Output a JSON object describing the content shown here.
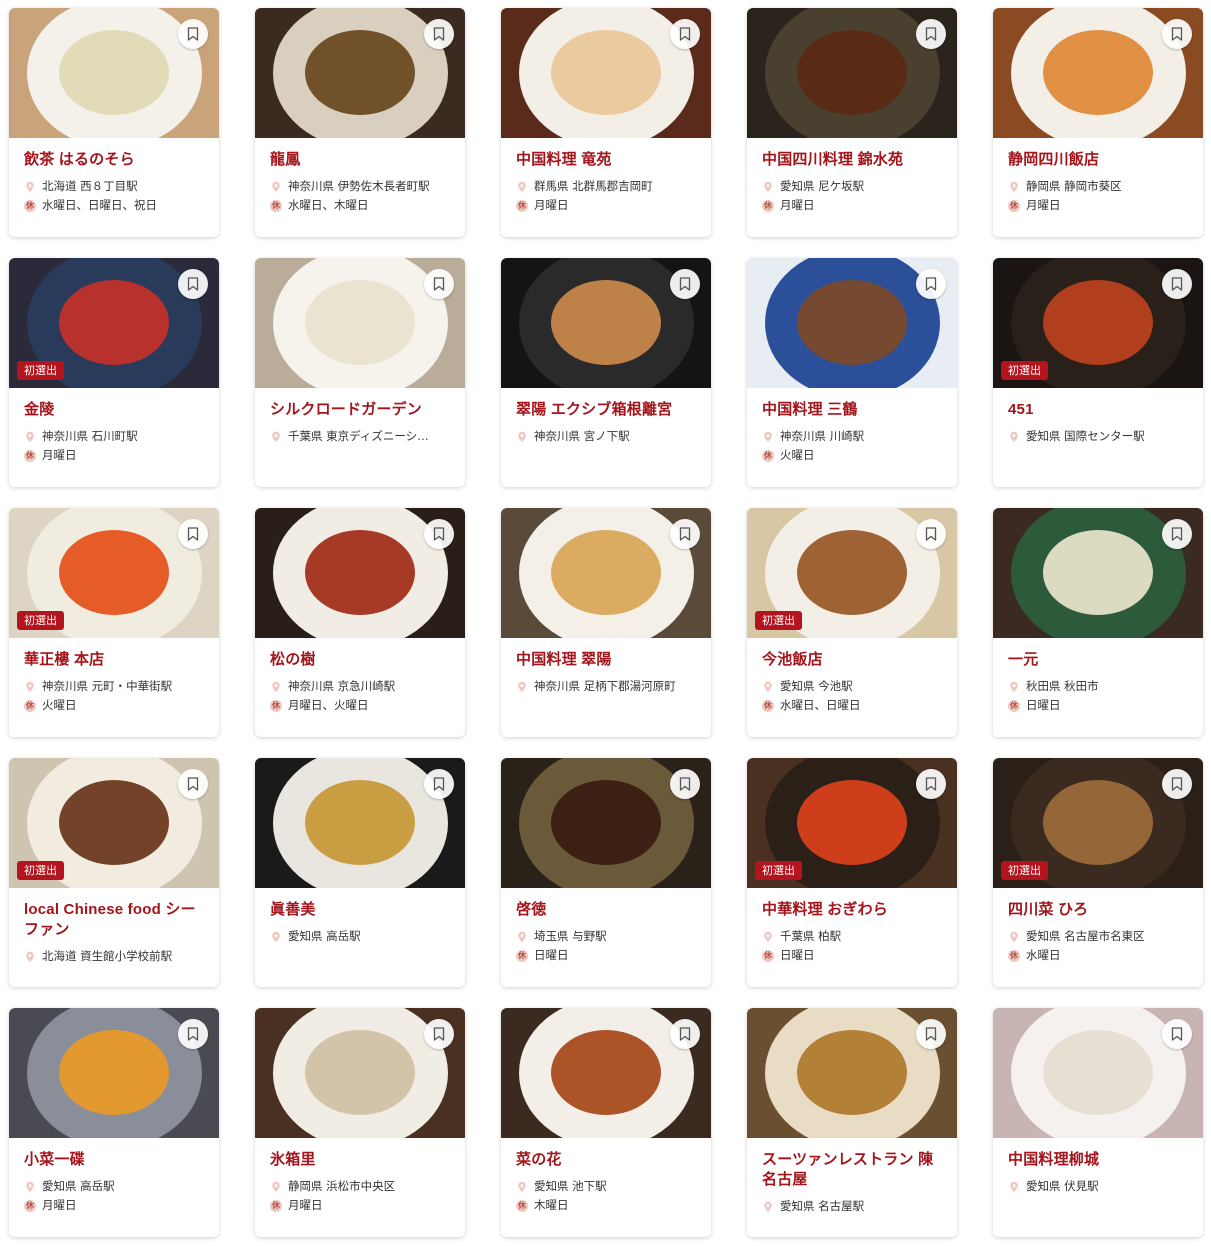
{
  "badge_label": "初選出",
  "holiday_mark": "休",
  "colors": {
    "name": "#a3141b",
    "badge": "#b3141e"
  },
  "cards": [
    {
      "name": "飲茶 はるのそら",
      "location": "北海道 西８丁目駅",
      "closed": "水曜日、日曜日、祝日",
      "badge": false,
      "photo": "#c9a47a",
      "plate": "#f4f1ea",
      "food": "#e0d9b5"
    },
    {
      "name": "龍鳳",
      "location": "神奈川県 伊勢佐木長者町駅",
      "closed": "水曜日、木曜日",
      "badge": false,
      "photo": "#3a2a20",
      "plate": "#d9cfbf",
      "food": "#6a4a22"
    },
    {
      "name": "中国料理 竜苑",
      "location": "群馬県 北群馬郡吉岡町",
      "closed": "月曜日",
      "badge": false,
      "photo": "#5a2a1a",
      "plate": "#f3eee6",
      "food": "#e9c79a"
    },
    {
      "name": "中国四川料理 錦水苑",
      "location": "愛知県 尼ケ坂駅",
      "closed": "月曜日",
      "badge": false,
      "photo": "#2a241c",
      "plate": "#4a4030",
      "food": "#5a2a14"
    },
    {
      "name": "静岡四川飯店",
      "location": "静岡県 静岡市葵区",
      "closed": "月曜日",
      "badge": false,
      "photo": "#8a4a22",
      "plate": "#f3eee6",
      "food": "#e08a3a"
    },
    {
      "name": "金陵",
      "location": "神奈川県 石川町駅",
      "closed": "月曜日",
      "badge": true,
      "photo": "#2a2a3a",
      "plate": "#2a3a5a",
      "food": "#c0302a"
    },
    {
      "name": "シルクロードガーデン",
      "location": "千葉県 東京ディズニーシ…",
      "closed": "",
      "badge": false,
      "photo": "#b9ad9a",
      "plate": "#f6f3ec",
      "food": "#e8e2cf"
    },
    {
      "name": "翠陽 エクシブ箱根離宮",
      "location": "神奈川県 宮ノ下駅",
      "closed": "",
      "badge": false,
      "photo": "#141414",
      "plate": "#2a2a2a",
      "food": "#c6864a"
    },
    {
      "name": "中国料理 三鶴",
      "location": "神奈川県 川崎駅",
      "closed": "火曜日",
      "badge": false,
      "photo": "#e8ecf3",
      "plate": "#2c4f9a",
      "food": "#7a4a2a"
    },
    {
      "name": "451",
      "location": "愛知県 国際センター駅",
      "closed": "",
      "badge": true,
      "photo": "#1a1412",
      "plate": "#2a201a",
      "food": "#b8401e"
    },
    {
      "name": "華正樓 本店",
      "location": "神奈川県 元町・中華街駅",
      "closed": "火曜日",
      "badge": true,
      "photo": "#ddd4c4",
      "plate": "#f1ece0",
      "food": "#e4541e"
    },
    {
      "name": "松の樹",
      "location": "神奈川県 京急川崎駅",
      "closed": "月曜日、火曜日",
      "badge": false,
      "photo": "#2a1e18",
      "plate": "#f2ede4",
      "food": "#a2301a"
    },
    {
      "name": "中国料理 翠陽",
      "location": "神奈川県 足柄下郡湯河原町",
      "closed": "",
      "badge": false,
      "photo": "#5a4a3a",
      "plate": "#f4f0e8",
      "food": "#d8a75a"
    },
    {
      "name": "今池飯店",
      "location": "愛知県 今池駅",
      "closed": "水曜日、日曜日",
      "badge": true,
      "photo": "#d8c7a4",
      "plate": "#f4efe6",
      "food": "#9a5a2a"
    },
    {
      "name": "一元",
      "location": "秋田県 秋田市",
      "closed": "日曜日",
      "badge": false,
      "photo": "#3a2a22",
      "plate": "#2d5a3a",
      "food": "#e6e2c8"
    },
    {
      "name": "local Chinese food シーファン",
      "location": "北海道 資生館小学校前駅",
      "closed": "",
      "badge": true,
      "photo": "#cfc4b0",
      "plate": "#f1ebe0",
      "food": "#6a3a1e"
    },
    {
      "name": "眞善美",
      "location": "愛知県 高岳駅",
      "closed": "",
      "badge": false,
      "photo": "#1a1a1a",
      "plate": "#e9e6e0",
      "food": "#c79a3a"
    },
    {
      "name": "啓徳",
      "location": "埼玉県 与野駅",
      "closed": "日曜日",
      "badge": false,
      "photo": "#2a2218",
      "plate": "#6a5a3a",
      "food": "#3a1e12"
    },
    {
      "name": "中華料理 おぎわら",
      "location": "千葉県 柏駅",
      "closed": "日曜日",
      "badge": true,
      "photo": "#4a3020",
      "plate": "#2a2018",
      "food": "#d8401a"
    },
    {
      "name": "四川菜 ひろ",
      "location": "愛知県 名古屋市名東区",
      "closed": "水曜日",
      "badge": true,
      "photo": "#2a2018",
      "plate": "#3a2a20",
      "food": "#9a6a3a"
    },
    {
      "name": "小菜一碟",
      "location": "愛知県 高岳駅",
      "closed": "月曜日",
      "badge": false,
      "photo": "#4a4a52",
      "plate": "#8a8e98",
      "food": "#e89a2a"
    },
    {
      "name": "氷箱里",
      "location": "静岡県 浜松市中央区",
      "closed": "月曜日",
      "badge": false,
      "photo": "#4a3020",
      "plate": "#f2ede4",
      "food": "#cfc2a4"
    },
    {
      "name": "菜の花",
      "location": "愛知県 池下駅",
      "closed": "木曜日",
      "badge": false,
      "photo": "#3a2a20",
      "plate": "#f3efe8",
      "food": "#a84a1e"
    },
    {
      "name": "スーツァンレストラン 陳 名古屋",
      "location": "愛知県 名古屋駅",
      "closed": "",
      "badge": false,
      "photo": "#6a5030",
      "plate": "#e8dcc4",
      "food": "#b07a30"
    },
    {
      "name": "中国料理柳城",
      "location": "愛知県 伏見駅",
      "closed": "",
      "badge": false,
      "photo": "#c9b4b4",
      "plate": "#f5f1ee",
      "food": "#e6dcd2"
    }
  ]
}
